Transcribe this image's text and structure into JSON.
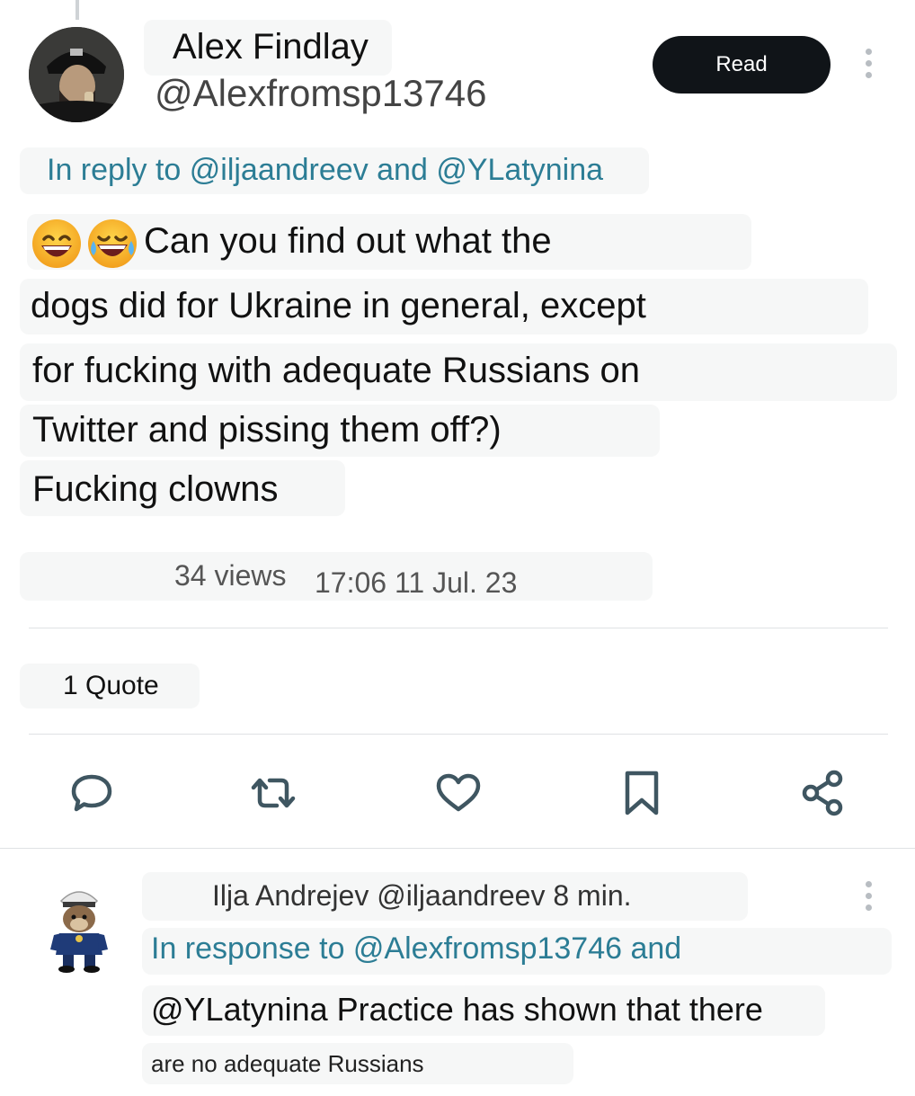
{
  "tweet": {
    "author_name": "Alex Findlay",
    "author_handle": "@Alexfromsp13746",
    "follow_button_label": "Read",
    "reply_to": "In reply to @iljaandreev and @YLatynina",
    "emojis": [
      "😄",
      "😂"
    ],
    "lines": [
      "Can you find out what the",
      "dogs did for Ukraine in general, except",
      "for fucking with adequate Russians on",
      "Twitter and pissing them off?)",
      "Fucking clowns"
    ],
    "timestamp": "17:06 11 Jul. 23",
    "views": "34 views",
    "quotes": "1 Quote"
  },
  "actions": [
    {
      "icon": "comment-icon"
    },
    {
      "icon": "retweet-icon"
    },
    {
      "icon": "heart-icon"
    },
    {
      "icon": "bookmark-icon"
    },
    {
      "icon": "share-icon"
    }
  ],
  "reply": {
    "header": "Ilja Andrejev @iljaandreev 8 min.",
    "reply_to": "In response to @Alexfromsp13746 and",
    "lines": [
      "@YLatynina Practice has shown that there",
      "are no adequate Russians"
    ]
  },
  "colors": {
    "link": "#2c7d95",
    "button_bg": "#101418",
    "icon": "#3f5661"
  }
}
